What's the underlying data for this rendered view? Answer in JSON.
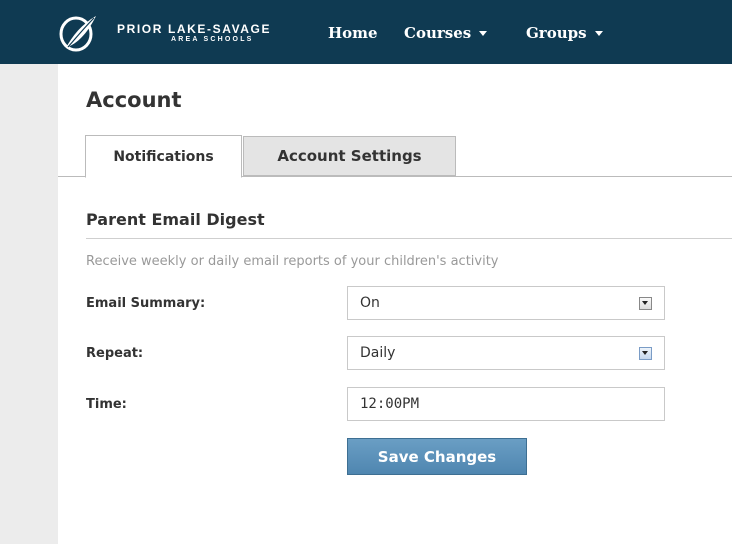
{
  "header": {
    "logo_line1": "PRIOR LAKE-SAVAGE",
    "logo_line2": "AREA SCHOOLS",
    "logo_icon": "leaf-logo-icon",
    "nav": {
      "home": "Home",
      "courses": "Courses",
      "groups": "Groups"
    }
  },
  "page": {
    "title": "Account",
    "tabs": [
      {
        "label": "Notifications",
        "active": true
      },
      {
        "label": "Account Settings",
        "active": false
      }
    ]
  },
  "section": {
    "heading": "Parent Email Digest",
    "description": "Receive weekly or daily email reports of your children's activity"
  },
  "form": {
    "email_summary": {
      "label": "Email Summary:",
      "value": "On"
    },
    "repeat": {
      "label": "Repeat:",
      "value": "Daily"
    },
    "time": {
      "label": "Time:",
      "value": "12:00PM"
    },
    "save_label": "Save Changes"
  },
  "colors": {
    "header_bg": "#0f3a52",
    "button_bg": "#5a91ba",
    "page_bg": "#f3f3f3"
  }
}
